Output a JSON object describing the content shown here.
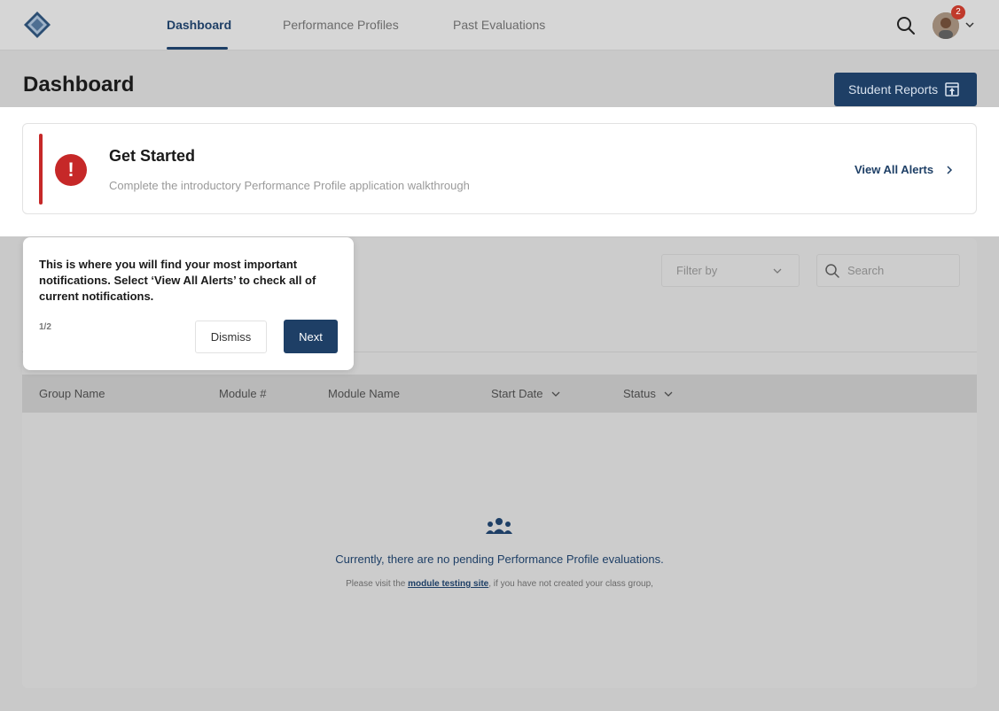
{
  "nav": {
    "tabs": [
      {
        "label": "Dashboard",
        "active": true
      },
      {
        "label": "Performance Profiles",
        "active": false
      },
      {
        "label": "Past Evaluations",
        "active": false
      }
    ],
    "notification_count": "2",
    "accent_color": "#1e3f66"
  },
  "header": {
    "title": "Dashboard",
    "reports_button": "Student Reports"
  },
  "alert": {
    "title": "Get Started",
    "description": "Complete the introductory Performance Profile application walkthrough",
    "view_all": "View All Alerts",
    "color": "#c62828"
  },
  "filters": {
    "filter_placeholder": "Filter by",
    "search_placeholder": "Search"
  },
  "table": {
    "columns": [
      "Group Name",
      "Module #",
      "Module Name",
      "Start Date",
      "Status"
    ]
  },
  "empty_state": {
    "title": "Currently, there are no pending Performance Profile evaluations.",
    "prefix": "Please visit the ",
    "link": "module testing site",
    "suffix": ", if you have not created your class group,"
  },
  "tooltip": {
    "text": "This is where you will find your most important notifications. Select ‘View All Alerts’ to check all of current notifications.",
    "step": "1/2",
    "dismiss": "Dismiss",
    "next": "Next"
  }
}
